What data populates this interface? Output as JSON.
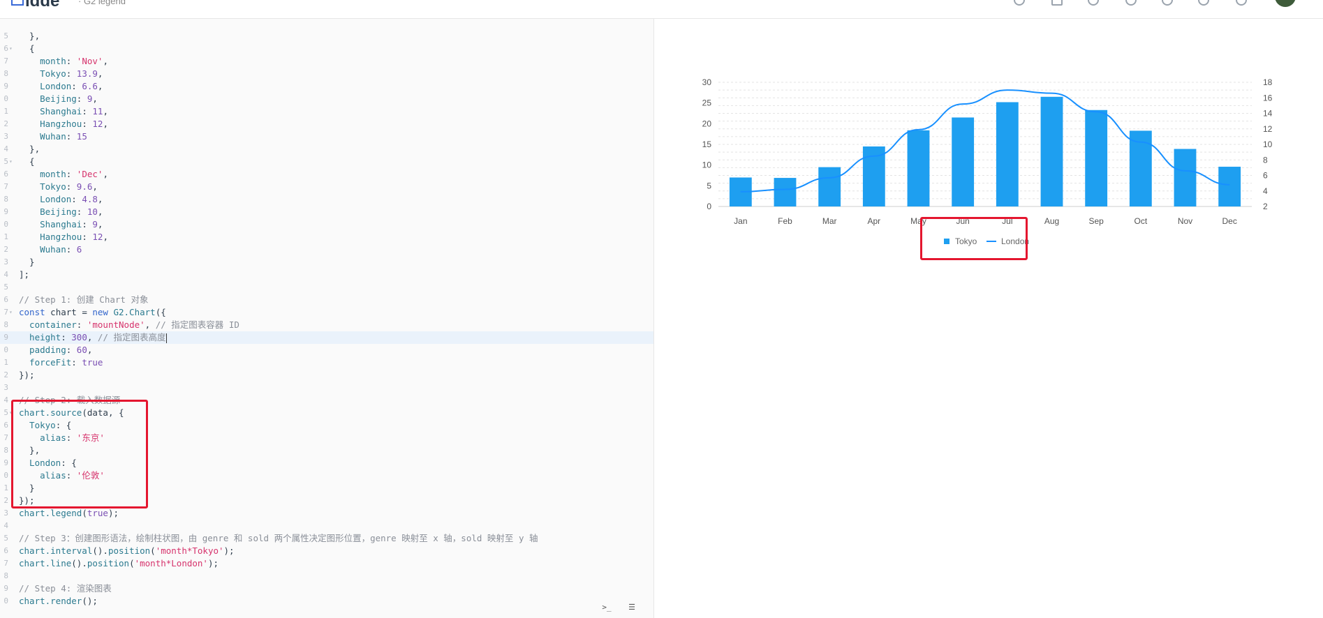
{
  "app": {
    "logo_text": "idde",
    "breadcrumb": "· G2 legend"
  },
  "code_lines": [
    {
      "n": "5",
      "fold": "",
      "hl": false,
      "parts": [
        [
          "p",
          "  },"
        ]
      ]
    },
    {
      "n": "6",
      "fold": "▾",
      "hl": false,
      "parts": [
        [
          "p",
          "  {"
        ]
      ]
    },
    {
      "n": "7",
      "fold": "",
      "hl": false,
      "parts": [
        [
          "prop",
          "    month"
        ],
        [
          "p",
          ": "
        ],
        [
          "str",
          "'Nov'"
        ],
        [
          "p",
          ","
        ]
      ]
    },
    {
      "n": "8",
      "fold": "",
      "hl": false,
      "parts": [
        [
          "prop",
          "    Tokyo"
        ],
        [
          "p",
          ": "
        ],
        [
          "num",
          "13.9"
        ],
        [
          "p",
          ","
        ]
      ]
    },
    {
      "n": "9",
      "fold": "",
      "hl": false,
      "parts": [
        [
          "prop",
          "    London"
        ],
        [
          "p",
          ": "
        ],
        [
          "num",
          "6.6"
        ],
        [
          "p",
          ","
        ]
      ]
    },
    {
      "n": "0",
      "fold": "",
      "hl": false,
      "parts": [
        [
          "prop",
          "    Beijing"
        ],
        [
          "p",
          ": "
        ],
        [
          "num",
          "9"
        ],
        [
          "p",
          ","
        ]
      ]
    },
    {
      "n": "1",
      "fold": "",
      "hl": false,
      "parts": [
        [
          "prop",
          "    Shanghai"
        ],
        [
          "p",
          ": "
        ],
        [
          "num",
          "11"
        ],
        [
          "p",
          ","
        ]
      ]
    },
    {
      "n": "2",
      "fold": "",
      "hl": false,
      "parts": [
        [
          "prop",
          "    Hangzhou"
        ],
        [
          "p",
          ": "
        ],
        [
          "num",
          "12"
        ],
        [
          "p",
          ","
        ]
      ]
    },
    {
      "n": "3",
      "fold": "",
      "hl": false,
      "parts": [
        [
          "prop",
          "    Wuhan"
        ],
        [
          "p",
          ": "
        ],
        [
          "num",
          "15"
        ]
      ]
    },
    {
      "n": "4",
      "fold": "",
      "hl": false,
      "parts": [
        [
          "p",
          "  },"
        ]
      ]
    },
    {
      "n": "5",
      "fold": "▾",
      "hl": false,
      "parts": [
        [
          "p",
          "  {"
        ]
      ]
    },
    {
      "n": "6",
      "fold": "",
      "hl": false,
      "parts": [
        [
          "prop",
          "    month"
        ],
        [
          "p",
          ": "
        ],
        [
          "str",
          "'Dec'"
        ],
        [
          "p",
          ","
        ]
      ]
    },
    {
      "n": "7",
      "fold": "",
      "hl": false,
      "parts": [
        [
          "prop",
          "    Tokyo"
        ],
        [
          "p",
          ": "
        ],
        [
          "num",
          "9.6"
        ],
        [
          "p",
          ","
        ]
      ]
    },
    {
      "n": "8",
      "fold": "",
      "hl": false,
      "parts": [
        [
          "prop",
          "    London"
        ],
        [
          "p",
          ": "
        ],
        [
          "num",
          "4.8"
        ],
        [
          "p",
          ","
        ]
      ]
    },
    {
      "n": "9",
      "fold": "",
      "hl": false,
      "parts": [
        [
          "prop",
          "    Beijing"
        ],
        [
          "p",
          ": "
        ],
        [
          "num",
          "10"
        ],
        [
          "p",
          ","
        ]
      ]
    },
    {
      "n": "0",
      "fold": "",
      "hl": false,
      "parts": [
        [
          "prop",
          "    Shanghai"
        ],
        [
          "p",
          ": "
        ],
        [
          "num",
          "9"
        ],
        [
          "p",
          ","
        ]
      ]
    },
    {
      "n": "1",
      "fold": "",
      "hl": false,
      "parts": [
        [
          "prop",
          "    Hangzhou"
        ],
        [
          "p",
          ": "
        ],
        [
          "num",
          "12"
        ],
        [
          "p",
          ","
        ]
      ]
    },
    {
      "n": "2",
      "fold": "",
      "hl": false,
      "parts": [
        [
          "prop",
          "    Wuhan"
        ],
        [
          "p",
          ": "
        ],
        [
          "num",
          "6"
        ]
      ]
    },
    {
      "n": "3",
      "fold": "",
      "hl": false,
      "parts": [
        [
          "p",
          "  }"
        ]
      ]
    },
    {
      "n": "4",
      "fold": "",
      "hl": false,
      "parts": [
        [
          "p",
          "];"
        ]
      ]
    },
    {
      "n": "5",
      "fold": "",
      "hl": false,
      "parts": [
        [
          "p",
          ""
        ]
      ]
    },
    {
      "n": "6",
      "fold": "",
      "hl": false,
      "parts": [
        [
          "cm",
          "// Step 1: 创建 Chart 对象"
        ]
      ]
    },
    {
      "n": "7",
      "fold": "▾",
      "hl": false,
      "parts": [
        [
          "kw",
          "const"
        ],
        [
          "p",
          " chart = "
        ],
        [
          "kw",
          "new"
        ],
        [
          "fn",
          " G2.Chart"
        ],
        [
          "p",
          "({"
        ]
      ]
    },
    {
      "n": "8",
      "fold": "",
      "hl": false,
      "parts": [
        [
          "prop",
          "  container"
        ],
        [
          "p",
          ": "
        ],
        [
          "str",
          "'mountNode'"
        ],
        [
          "p",
          ", "
        ],
        [
          "cm",
          "// 指定图表容器 ID"
        ]
      ]
    },
    {
      "n": "9",
      "fold": "",
      "hl": true,
      "parts": [
        [
          "prop",
          "  height"
        ],
        [
          "p",
          ": "
        ],
        [
          "num",
          "300"
        ],
        [
          "p",
          ", "
        ],
        [
          "cm",
          "// 指定图表高度"
        ],
        [
          "cursor",
          ""
        ]
      ]
    },
    {
      "n": "0",
      "fold": "",
      "hl": false,
      "parts": [
        [
          "prop",
          "  padding"
        ],
        [
          "p",
          ": "
        ],
        [
          "num",
          "60"
        ],
        [
          "p",
          ","
        ]
      ]
    },
    {
      "n": "1",
      "fold": "",
      "hl": false,
      "parts": [
        [
          "prop",
          "  forceFit"
        ],
        [
          "p",
          ": "
        ],
        [
          "num",
          "true"
        ]
      ]
    },
    {
      "n": "2",
      "fold": "",
      "hl": false,
      "parts": [
        [
          "p",
          "});"
        ]
      ]
    },
    {
      "n": "3",
      "fold": "",
      "hl": false,
      "parts": [
        [
          "p",
          ""
        ]
      ]
    },
    {
      "n": "4",
      "fold": "",
      "hl": false,
      "parts": [
        [
          "cm",
          "// Step 2: 载入数据源"
        ]
      ]
    },
    {
      "n": "5",
      "fold": "▾",
      "hl": false,
      "parts": [
        [
          "fn",
          "chart.source"
        ],
        [
          "p",
          "(data, {"
        ]
      ]
    },
    {
      "n": "6",
      "fold": "",
      "hl": false,
      "parts": [
        [
          "prop",
          "  Tokyo"
        ],
        [
          "p",
          ": {"
        ]
      ]
    },
    {
      "n": "7",
      "fold": "",
      "hl": false,
      "parts": [
        [
          "prop",
          "    alias"
        ],
        [
          "p",
          ": "
        ],
        [
          "str",
          "'东京'"
        ]
      ]
    },
    {
      "n": "8",
      "fold": "",
      "hl": false,
      "parts": [
        [
          "p",
          "  },"
        ]
      ]
    },
    {
      "n": "9",
      "fold": "",
      "hl": false,
      "parts": [
        [
          "prop",
          "  London"
        ],
        [
          "p",
          ": {"
        ]
      ]
    },
    {
      "n": "0",
      "fold": "",
      "hl": false,
      "parts": [
        [
          "prop",
          "    alias"
        ],
        [
          "p",
          ": "
        ],
        [
          "str",
          "'伦敦'"
        ]
      ]
    },
    {
      "n": "1",
      "fold": "",
      "hl": false,
      "parts": [
        [
          "p",
          "  }"
        ]
      ]
    },
    {
      "n": "2",
      "fold": "",
      "hl": false,
      "parts": [
        [
          "p",
          "});"
        ]
      ]
    },
    {
      "n": "3",
      "fold": "",
      "hl": false,
      "parts": [
        [
          "fn",
          "chart.legend"
        ],
        [
          "p",
          "("
        ],
        [
          "num",
          "true"
        ],
        [
          "p",
          ");"
        ]
      ]
    },
    {
      "n": "4",
      "fold": "",
      "hl": false,
      "parts": [
        [
          "p",
          ""
        ]
      ]
    },
    {
      "n": "5",
      "fold": "",
      "hl": false,
      "parts": [
        [
          "cm",
          "// Step 3：创建图形语法，绘制柱状图，由 genre 和 sold 两个属性决定图形位置，genre 映射至 x 轴，sold 映射至 y 轴"
        ]
      ]
    },
    {
      "n": "6",
      "fold": "",
      "hl": false,
      "parts": [
        [
          "fn",
          "chart.interval"
        ],
        [
          "p",
          "()."
        ],
        [
          "fn",
          "position"
        ],
        [
          "p",
          "("
        ],
        [
          "str",
          "'month*Tokyo'"
        ],
        [
          "p",
          ");"
        ]
      ]
    },
    {
      "n": "7",
      "fold": "",
      "hl": false,
      "parts": [
        [
          "fn",
          "chart.line"
        ],
        [
          "p",
          "()."
        ],
        [
          "fn",
          "position"
        ],
        [
          "p",
          "("
        ],
        [
          "str",
          "'month*London'"
        ],
        [
          "p",
          ");"
        ]
      ]
    },
    {
      "n": "8",
      "fold": "",
      "hl": false,
      "parts": [
        [
          "p",
          ""
        ]
      ]
    },
    {
      "n": "9",
      "fold": "",
      "hl": false,
      "parts": [
        [
          "cm",
          "// Step 4: 渲染图表"
        ]
      ]
    },
    {
      "n": "0",
      "fold": "",
      "hl": false,
      "parts": [
        [
          "fn",
          "chart.render"
        ],
        [
          "p",
          "();"
        ]
      ]
    }
  ],
  "editor_buttons": {
    "console": ">_",
    "format": "☰"
  },
  "chart_data": {
    "type": "bar",
    "categories": [
      "Jan",
      "Feb",
      "Mar",
      "Apr",
      "May",
      "Jun",
      "Jul",
      "Aug",
      "Sep",
      "Oct",
      "Nov",
      "Dec"
    ],
    "series": [
      {
        "name": "Tokyo",
        "kind": "bar",
        "axis": "left",
        "values": [
          7.0,
          6.9,
          9.5,
          14.5,
          18.4,
          21.5,
          25.2,
          26.5,
          23.3,
          18.3,
          13.9,
          9.6
        ]
      },
      {
        "name": "London",
        "kind": "line",
        "axis": "right",
        "values": [
          3.9,
          4.2,
          5.7,
          8.5,
          11.9,
          15.2,
          17.0,
          16.6,
          14.2,
          10.3,
          6.6,
          4.8
        ]
      }
    ],
    "ylim_left": [
      0,
      30
    ],
    "yticks_left": [
      0,
      5,
      10,
      15,
      20,
      25,
      30
    ],
    "ylim_right": [
      2,
      18
    ],
    "yticks_right": [
      2,
      4,
      6,
      8,
      10,
      12,
      14,
      16,
      18
    ],
    "grid": true,
    "legend": "bottom",
    "colors": {
      "bar": "#1e9ff0",
      "line": "#1890ff",
      "grid": "#e3e3e3",
      "tick": "#545454"
    }
  }
}
